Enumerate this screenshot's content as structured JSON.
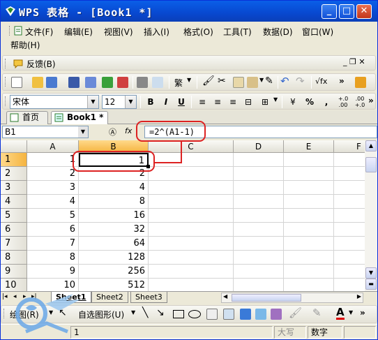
{
  "window": {
    "title": "WPS 表格 - [Book1 *]"
  },
  "menu": {
    "items": [
      "文件(F)",
      "编辑(E)",
      "视图(V)",
      "插入(I)",
      "格式(O)",
      "工具(T)",
      "数据(D)",
      "窗口(W)",
      "帮助(H)"
    ],
    "feedback": "反馈(B)"
  },
  "font": {
    "name": "宋体",
    "size": "12"
  },
  "format_buttons": {
    "bold": "B",
    "italic": "I",
    "underline": "U",
    "percent": "%",
    "comma": ","
  },
  "doc_tabs": [
    {
      "label": "首页",
      "active": false
    },
    {
      "label": "Book1 *",
      "active": true
    }
  ],
  "namebox": "B1",
  "formula": "=2^(A1-1)",
  "columns": [
    "A",
    "B",
    "C",
    "D",
    "E",
    "F"
  ],
  "rows": [
    {
      "num": "1",
      "a": "1",
      "b": "1"
    },
    {
      "num": "2",
      "a": "2",
      "b": "2"
    },
    {
      "num": "3",
      "a": "3",
      "b": "4"
    },
    {
      "num": "4",
      "a": "4",
      "b": "8"
    },
    {
      "num": "5",
      "a": "5",
      "b": "16"
    },
    {
      "num": "6",
      "a": "6",
      "b": "32"
    },
    {
      "num": "7",
      "a": "7",
      "b": "64"
    },
    {
      "num": "8",
      "a": "8",
      "b": "128"
    },
    {
      "num": "9",
      "a": "9",
      "b": "256"
    },
    {
      "num": "10",
      "a": "10",
      "b": "512"
    }
  ],
  "sheets": [
    "Sheet1",
    "Sheet2",
    "Sheet3"
  ],
  "drawing": {
    "draw": "绘图(R)",
    "autoshapes": "自选图形(U)"
  },
  "status": {
    "page": "1",
    "caps": "大写",
    "num": "数字"
  },
  "colors": {
    "title_blue": "#0a5fe8",
    "callout_red": "#dd2222",
    "font_color_red": "#dd0000"
  }
}
